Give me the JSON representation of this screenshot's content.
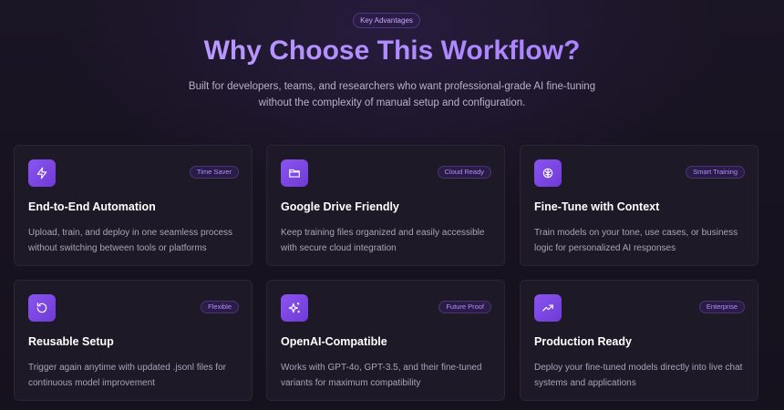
{
  "hero": {
    "pill": "Key Advantages",
    "title": "Why Choose This Workflow?",
    "subtitle_line1": "Built for developers, teams, and researchers who want professional-grade AI fine-tuning",
    "subtitle_line2": "without the complexity of manual setup and configuration."
  },
  "cards": [
    {
      "icon": "lightning-icon",
      "badge": "Time Saver",
      "title": "End-to-End Automation",
      "desc": "Upload, train, and deploy in one seamless process without switching between tools or platforms"
    },
    {
      "icon": "folder-icon",
      "badge": "Cloud Ready",
      "title": "Google Drive Friendly",
      "desc": "Keep training files organized and easily accessible with secure cloud integration"
    },
    {
      "icon": "brain-icon",
      "badge": "Smart Training",
      "title": "Fine-Tune with Context",
      "desc": "Train models on your tone, use cases, or business logic for personalized AI responses"
    },
    {
      "icon": "refresh-icon",
      "badge": "Flexible",
      "title": "Reusable Setup",
      "desc": "Trigger again anytime with updated .jsonl files for continuous model improvement"
    },
    {
      "icon": "sparkles-icon",
      "badge": "Future Proof",
      "title": "OpenAI-Compatible",
      "desc": "Works with GPT-4o, GPT-3.5, and their fine-tuned variants for maximum compatibility"
    },
    {
      "icon": "trending-up-icon",
      "badge": "Enterprise",
      "title": "Production Ready",
      "desc": "Deploy your fine-tuned models directly into live chat systems and applications"
    }
  ],
  "colors": {
    "background": "#16121f",
    "card": "#1d1927",
    "accent": "#8b54f0",
    "badge_text": "#b48cff"
  }
}
